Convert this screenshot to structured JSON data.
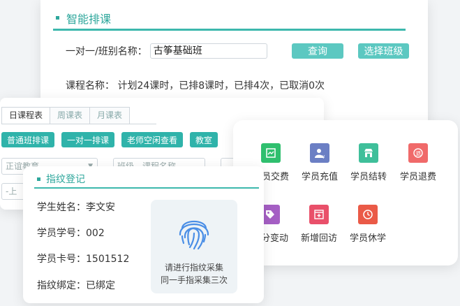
{
  "schedule": {
    "title": "智能排课",
    "class_label": "一对一/班别名称：",
    "class_value": "古筝基础班",
    "query_button": "查询",
    "choose_class_button": "选择班级",
    "course_info": "课程名称： 计划24课时，已排8课时，已排4次，已取消0次"
  },
  "daily": {
    "tabs": [
      "日课程表",
      "周课表",
      "月课表"
    ],
    "buttons": [
      "普通班排课",
      "一对一排课",
      "老师空闲查看",
      "教室"
    ],
    "filter1": "正谊教育",
    "filter2": "班级、课程名称",
    "filter3": "-上"
  },
  "fingerprint": {
    "title": "指纹登记",
    "name_label": "学生姓名：",
    "name_value": "李文安",
    "id_label": "学员学号：",
    "id_value": "002",
    "card_label": "学员卡号：",
    "card_value": "1501512",
    "bind_label": "指纹绑定：",
    "bind_value": "已绑定",
    "hint_line1": "请进行指纹采集",
    "hint_line2": "同一手指采集三次"
  },
  "actions": {
    "items": [
      {
        "label": "学员交费",
        "color": "#2fbf6e",
        "icon": "payment-icon"
      },
      {
        "label": "学员充值",
        "color": "#6b7fc4",
        "icon": "recharge-icon"
      },
      {
        "label": "学员结转",
        "color": "#3fbf9a",
        "icon": "transfer-icon"
      },
      {
        "label": "学员退费",
        "color": "#f06a6a",
        "icon": "refund-icon"
      },
      {
        "label": "积分变动",
        "color": "#a55fc4",
        "icon": "points-icon"
      },
      {
        "label": "新增回访",
        "color": "#e9506a",
        "icon": "revisit-icon"
      },
      {
        "label": "学员休学",
        "color": "#ea5a47",
        "icon": "suspend-icon"
      }
    ]
  }
}
